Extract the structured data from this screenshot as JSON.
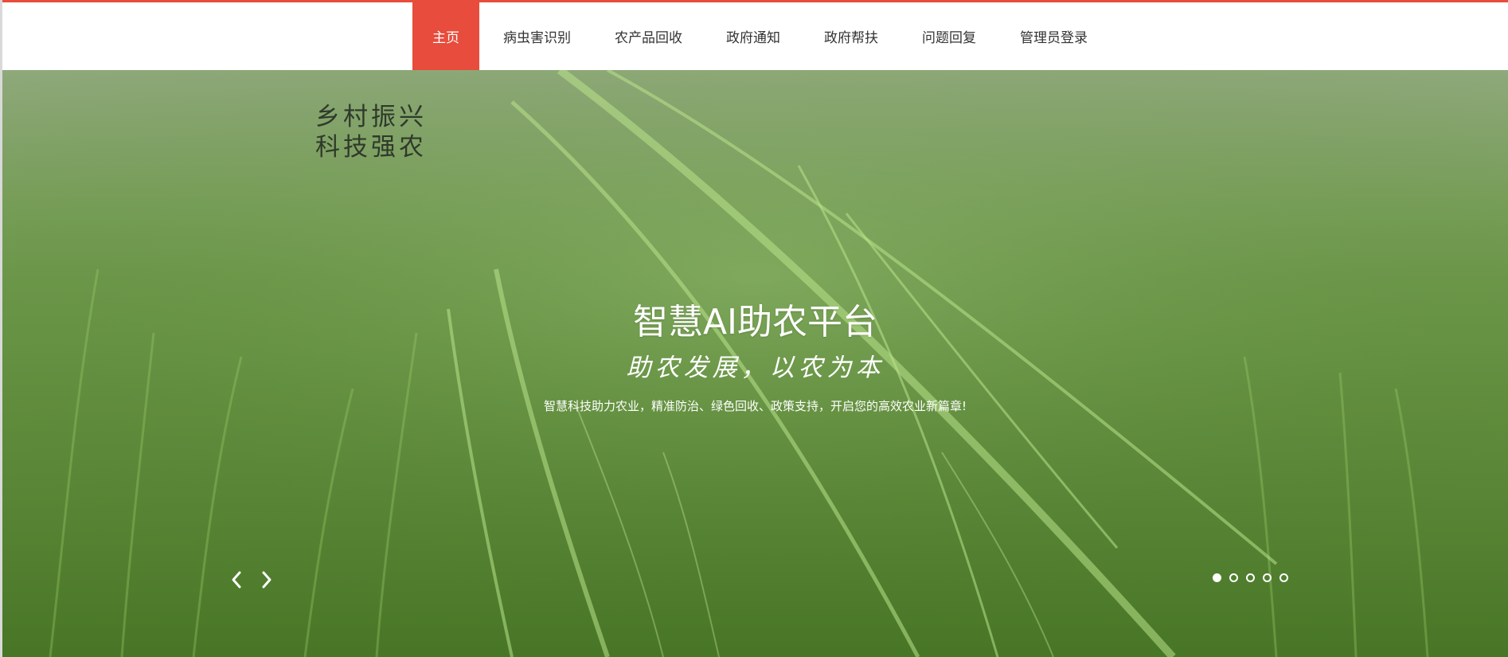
{
  "nav": {
    "items": [
      {
        "label": "主页",
        "active": true
      },
      {
        "label": "病虫害识别",
        "active": false
      },
      {
        "label": "农产品回收",
        "active": false
      },
      {
        "label": "政府通知",
        "active": false
      },
      {
        "label": "政府帮扶",
        "active": false
      },
      {
        "label": "问题回复",
        "active": false
      },
      {
        "label": "管理员登录",
        "active": false
      }
    ]
  },
  "hero": {
    "slogan_line1": "乡村振兴",
    "slogan_line2": "科技强农",
    "title": "智慧AI助农平台",
    "subtitle": "助农发展，以农为本",
    "description": "智慧科技助力农业，精准防治、绿色回收、政策支持，开启您的高效农业新篇章!",
    "carousel": {
      "prev_icon": "chevron-left-icon",
      "next_icon": "chevron-right-icon",
      "slide_count": 5,
      "active_slide": 1
    }
  },
  "colors": {
    "accent": "#e74c3c",
    "nav_text": "#333333",
    "hero_text": "#ffffff"
  }
}
